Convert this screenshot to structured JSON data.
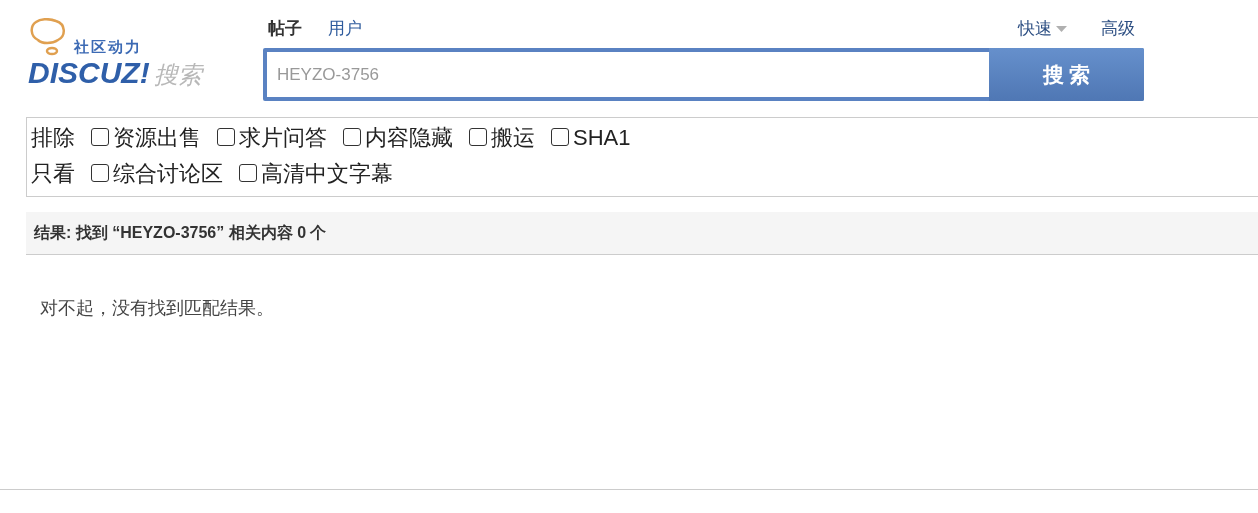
{
  "logo": {
    "tagline": "社区动力",
    "brand": "DISCUZ!",
    "suffix": "搜索"
  },
  "tabs": [
    {
      "label": "帖子",
      "selected": true
    },
    {
      "label": "用户",
      "selected": false
    }
  ],
  "links": {
    "quick": "快速",
    "advanced": "高级"
  },
  "search": {
    "value": "HEYZO-3756",
    "button": "搜 索"
  },
  "filters": [
    {
      "label": "排除",
      "options": [
        {
          "label": "资源出售",
          "checked": false
        },
        {
          "label": "求片问答",
          "checked": false
        },
        {
          "label": "内容隐藏",
          "checked": false
        },
        {
          "label": "搬运",
          "checked": false
        },
        {
          "label": "SHA1",
          "checked": false
        }
      ]
    },
    {
      "label": "只看",
      "options": [
        {
          "label": "综合讨论区",
          "checked": false
        },
        {
          "label": "高清中文字幕",
          "checked": false
        }
      ]
    }
  ],
  "result": {
    "summary": "结果: 找到 “HEYZO-3756” 相关内容 0 个",
    "message": "对不起，没有找到匹配结果。"
  }
}
